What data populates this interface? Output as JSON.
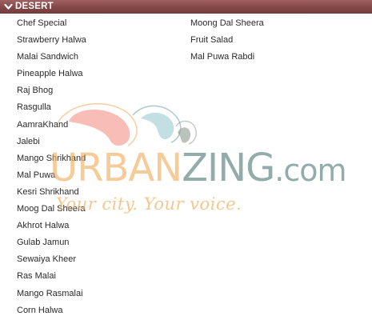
{
  "section": {
    "title": "DESERT",
    "toggle_icon": "chevron-down-icon"
  },
  "menu": {
    "left_column": [
      "Chef Special",
      "Strawberry Halwa",
      "Malai Sandwich",
      "Pineapple Halwa",
      "Raj Bhog",
      "Rasgulla",
      "AamraKhand",
      "Jalebi",
      "Mango Shrikhand",
      "Mal Puwa",
      "Kesri Shrikhand",
      "Moog Dal Sheera",
      "Akhrot Halwa",
      "Gulab Jamun",
      "Sewaiya Kheer",
      "Ras Malai",
      "Mango Rasmalai",
      "Corn Halwa"
    ],
    "right_column": [
      "Moong Dal Sheera",
      "Fruit Salad",
      "Mal Puwa Rabdi"
    ]
  },
  "watermark": {
    "brand_part1": "URBAN",
    "brand_part2": "ZING",
    "brand_suffix": ".com",
    "tagline": "Your city. Your voice."
  },
  "colors": {
    "header_bg": "#854848",
    "header_text": "#ffffff",
    "item_text": "#2a2a2a",
    "watermark_orange": "#f0af5f",
    "watermark_teal": "#6e918c",
    "watermark_pink": "#f4a49a",
    "watermark_light_teal": "#aed6da"
  }
}
